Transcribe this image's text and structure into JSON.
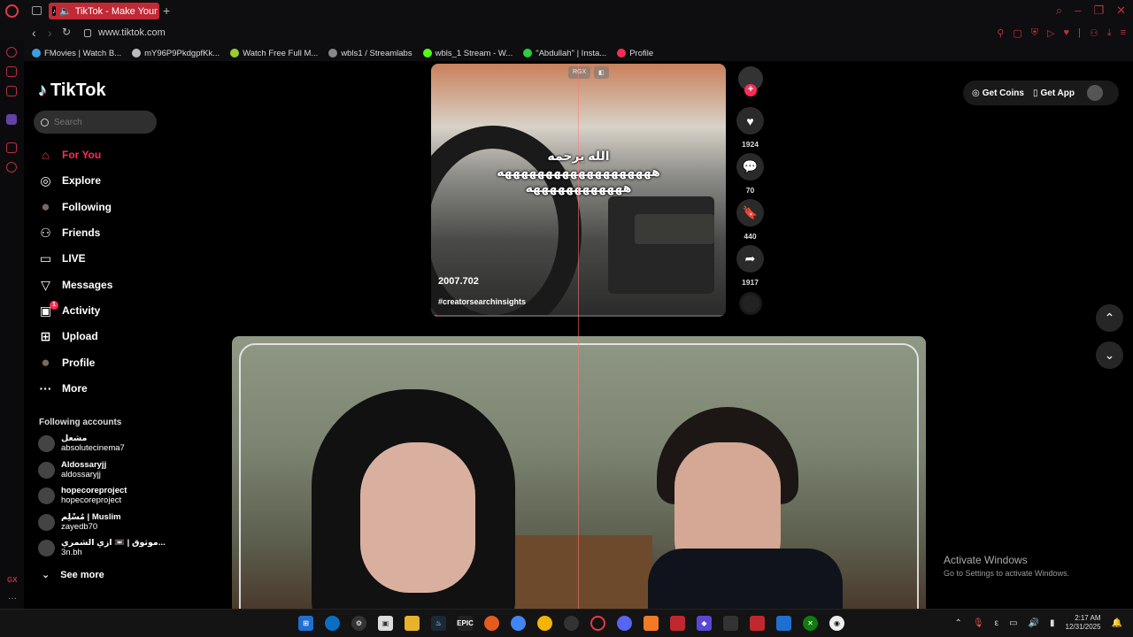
{
  "browser": {
    "tab_title": "TikTok - Make Your Da",
    "url": "www.tiktok.com",
    "bookmarks": [
      {
        "label": "FMovies | Watch B...",
        "color": "#3aa0e0"
      },
      {
        "label": "mY96P9PkdgpfKk...",
        "color": "#bbbbbb"
      },
      {
        "label": "Watch Free Full M...",
        "color": "#9acd32"
      },
      {
        "label": "wbls1 / Streamlabs",
        "color": "#888888"
      },
      {
        "label": "wbls_1 Stream - W...",
        "color": "#53fc18"
      },
      {
        "label": "\"Abdullah\" | Insta...",
        "color": "#2ecc40"
      },
      {
        "label": "Profile",
        "color": "#fe2c55"
      }
    ]
  },
  "tiktok": {
    "logo": "TikTok",
    "search_placeholder": "Search",
    "nav": [
      {
        "label": "For You",
        "icon": "home-icon",
        "active": true
      },
      {
        "label": "Explore",
        "icon": "compass-icon"
      },
      {
        "label": "Following",
        "icon": "following-avatar-icon"
      },
      {
        "label": "Friends",
        "icon": "friends-icon"
      },
      {
        "label": "LIVE",
        "icon": "live-icon"
      },
      {
        "label": "Messages",
        "icon": "messages-icon"
      },
      {
        "label": "Activity",
        "icon": "activity-icon",
        "badge": "1"
      },
      {
        "label": "Upload",
        "icon": "upload-icon"
      },
      {
        "label": "Profile",
        "icon": "profile-avatar-icon"
      },
      {
        "label": "More",
        "icon": "more-icon"
      }
    ],
    "following_header": "Following accounts",
    "following": [
      {
        "name": "مشعل",
        "handle": "absolutecinema7"
      },
      {
        "name": "Aldossaryjj",
        "handle": "aldossaryjj"
      },
      {
        "name": "hopecoreproject",
        "handle": "hopecoreproject"
      },
      {
        "name": "مُسْلِم | Muslim",
        "handle": "zayedb70"
      },
      {
        "name": "موثوق | 📼 ازي الشمري...",
        "handle": "3n.bh"
      }
    ],
    "see_more": "See more"
  },
  "video1": {
    "chips": [
      "RGX",
      "◧"
    ],
    "caption_lines": [
      "الله يرحمه",
      "هههههههههههههههههههه",
      "ههههههههههههه"
    ],
    "username": "2007.702",
    "hashtag": "#creatorsearchinsights",
    "progress": 0.02,
    "actions": {
      "likes": "1924",
      "comments": "70",
      "saves": "440",
      "shares": "1917"
    }
  },
  "topright": {
    "get_coins": "Get Coins",
    "get_app": "Get App"
  },
  "watermark": {
    "line1": "Activate Windows",
    "line2": "Go to Settings to activate Windows."
  },
  "taskbar": {
    "time": "2:17 AM",
    "date": "12/31/2025",
    "lang": "ε"
  }
}
